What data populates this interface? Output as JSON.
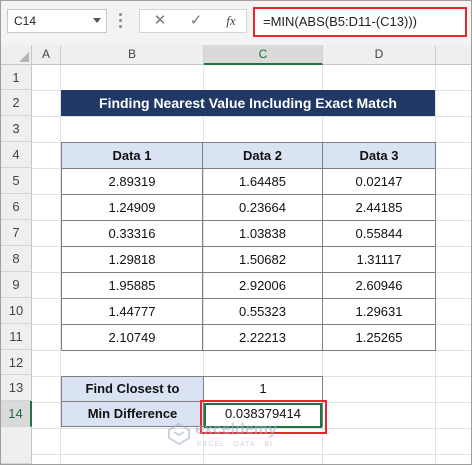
{
  "name_box": "C14",
  "formula_bar": {
    "cancel_glyph": "✕",
    "enter_glyph": "✓",
    "fx_label": "fx",
    "formula": "=MIN(ABS(B5:D11-(C13)))"
  },
  "columns": [
    "A",
    "B",
    "C",
    "D"
  ],
  "rows": [
    "1",
    "2",
    "3",
    "4",
    "5",
    "6",
    "7",
    "8",
    "9",
    "10",
    "11",
    "12",
    "13",
    "14"
  ],
  "title": "Finding Nearest Value Including Exact Match",
  "table": {
    "headers": [
      "Data 1",
      "Data 2",
      "Data 3"
    ],
    "rows": [
      [
        "2.89319",
        "1.64485",
        "0.02147"
      ],
      [
        "1.24909",
        "0.23664",
        "2.44185"
      ],
      [
        "0.33316",
        "1.03838",
        "0.55844"
      ],
      [
        "1.29818",
        "1.50682",
        "1.31117"
      ],
      [
        "1.95885",
        "2.92006",
        "2.60946"
      ],
      [
        "1.44777",
        "0.55323",
        "1.29631"
      ],
      [
        "2.10749",
        "2.22213",
        "1.25265"
      ]
    ]
  },
  "find_closest": {
    "label": "Find Closest to",
    "value": "1"
  },
  "min_difference": {
    "label": "Min Difference",
    "value": "0.038379414"
  },
  "watermark": {
    "name": "exceldemy",
    "tagline": "EXCEL · DATA · BI"
  },
  "colors": {
    "title_bg": "#1f3864",
    "header_bg": "#dae3f3",
    "highlight": "#e8262b",
    "excel_green": "#217346"
  }
}
